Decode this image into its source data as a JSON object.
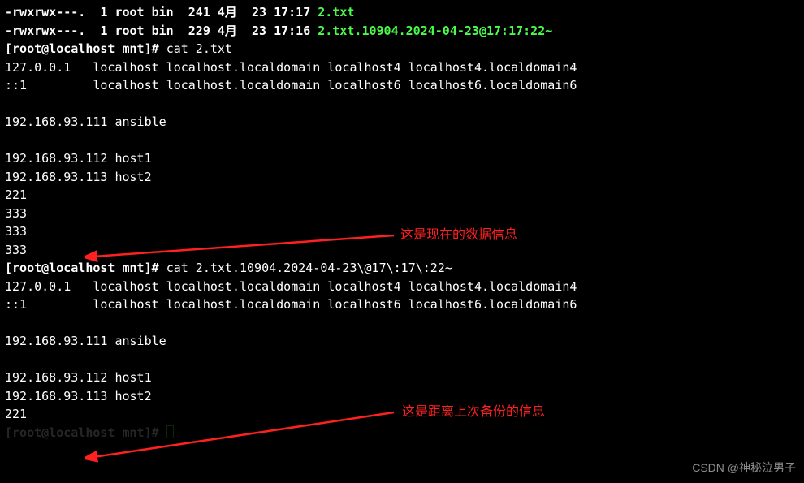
{
  "ls": {
    "line1_perm": "-rwxrwx---.  1 root bin  241 4月  23 17:17 ",
    "line1_file": "2.txt",
    "line2_perm": "-rwxrwx---.  1 root bin  229 4月  23 17:16 ",
    "line2_file": "2.txt.10904.2024-04-23@17:17:22~"
  },
  "prompt1": "[root@localhost mnt]# ",
  "cmd1": "cat 2.txt",
  "output1": [
    "127.0.0.1   localhost localhost.localdomain localhost4 localhost4.localdomain4",
    "::1         localhost localhost.localdomain localhost6 localhost6.localdomain6",
    "",
    "192.168.93.111 ansible",
    "",
    "192.168.93.112 host1",
    "192.168.93.113 host2",
    "221",
    "333",
    "333",
    "333"
  ],
  "prompt2": "[root@localhost mnt]# ",
  "cmd2": "cat 2.txt.10904.2024-04-23\\@17\\:17\\:22~",
  "output2": [
    "127.0.0.1   localhost localhost.localdomain localhost4 localhost4.localdomain4",
    "::1         localhost localhost.localdomain localhost6 localhost6.localdomain6",
    "",
    "192.168.93.111 ansible",
    "",
    "192.168.93.112 host1",
    "192.168.93.113 host2",
    "221"
  ],
  "prompt3_partial": "[root@localhost mnt]# ",
  "annotations": {
    "a1": "这是现在的数据信息",
    "a2": "这是距离上次备份的信息"
  },
  "watermark": "CSDN @神秘泣男子"
}
